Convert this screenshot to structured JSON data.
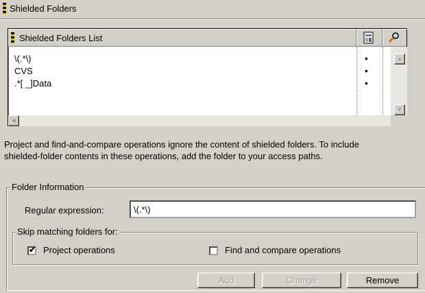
{
  "header": {
    "title": "Shielded Folders"
  },
  "list": {
    "column_name": "Shielded Folders List",
    "column_a_icon": "document-icon",
    "column_b_icon": "magnifier-icon",
    "rows": [
      {
        "name": "\\(.*\\)",
        "a": "•",
        "b": ""
      },
      {
        "name": "CVS",
        "a": "•",
        "b": "•"
      },
      {
        "name": ".*[ _]Data",
        "a": "•",
        "b": "•"
      }
    ]
  },
  "description": {
    "line1": "Project and find-and-compare operations ignore the content of shielded folders. To include",
    "line2": "shielded-folder contents in these operations, add the folder to your access paths."
  },
  "folder_info": {
    "title": "Folder Information",
    "regex_label": "Regular expression:",
    "regex_value": "\\(.*\\)",
    "skip_title": "Skip matching folders for:",
    "project_ops_label": "Project operations",
    "project_ops_checked": true,
    "find_ops_label": "Find and compare operations",
    "find_ops_checked": false
  },
  "buttons": {
    "add": "Add",
    "change": "Change",
    "remove": "Remove"
  }
}
